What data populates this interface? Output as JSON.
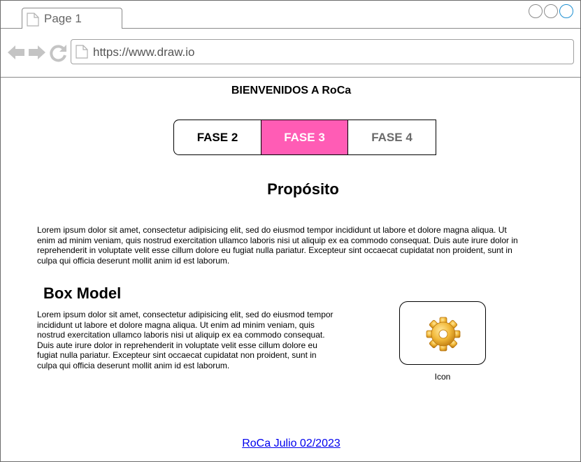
{
  "browser": {
    "tab_title": "Page 1",
    "url": "https://www.draw.io"
  },
  "page": {
    "title": "BIENVENIDOS A RoCa",
    "phases": [
      "FASE 2",
      "FASE 3",
      "FASE 4"
    ],
    "active_phase": "FASE 3",
    "active_color": "#ff5cb5",
    "purpose_heading": "Propósito",
    "purpose_text": "Lorem ipsum dolor sit amet, consectetur adipisicing elit, sed do eiusmod tempor incididunt ut labore et dolore magna aliqua. Ut enim ad minim veniam, quis nostrud exercitation ullamco laboris nisi ut aliquip ex ea commodo consequat. Duis aute irure dolor in reprehenderit in voluptate velit esse cillum dolore eu fugiat nulla pariatur. Excepteur sint occaecat cupidatat non proident, sunt in culpa qui officia deserunt mollit anim id est laborum.",
    "box_heading": "Box Model",
    "box_text": "Lorem ipsum dolor sit amet, consectetur adipisicing elit, sed do eiusmod tempor incididunt ut labore et dolore magna aliqua. Ut enim ad minim veniam, quis nostrud exercitation ullamco laboris nisi ut aliquip ex ea commodo consequat. Duis aute irure dolor in reprehenderit in voluptate velit esse cillum dolore eu fugiat nulla pariatur. Excepteur sint occaecat cupidatat non proident, sunt in culpa qui officia deserunt mollit anim id est laborum.",
    "icon_name": "gear-icon",
    "icon_caption": "Icon",
    "footer_link": "RoCa Julio 02/2023"
  }
}
